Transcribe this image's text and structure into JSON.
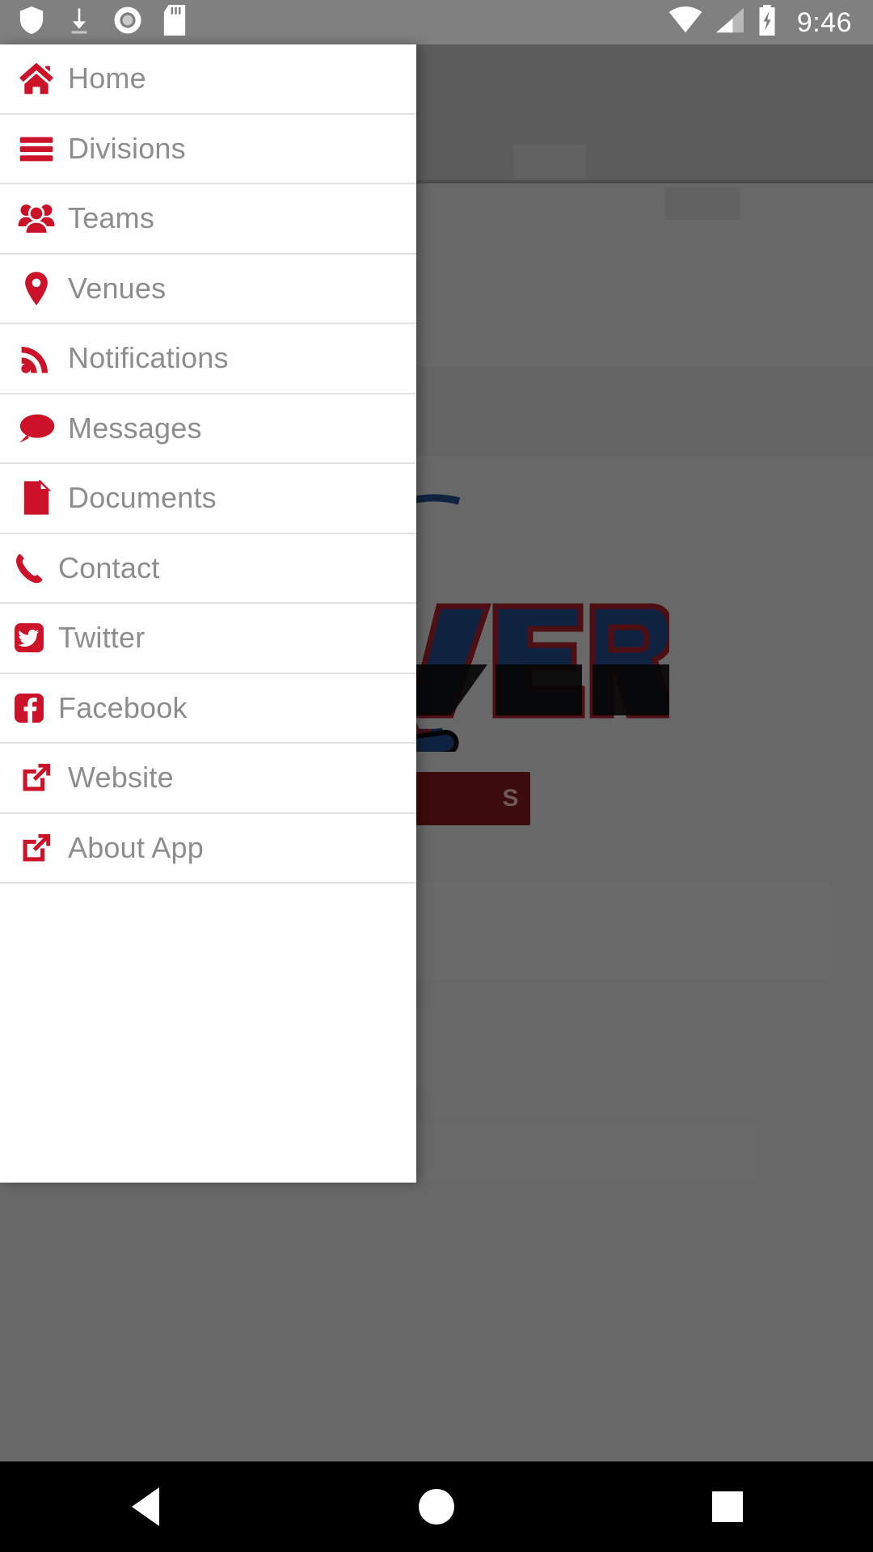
{
  "status_bar": {
    "time": "9:46",
    "left_icons": [
      "shield-icon",
      "download-icon",
      "disc-icon",
      "sd-card-icon"
    ],
    "right_icons": [
      "wifi-icon",
      "cell-signal-icon",
      "battery-charging-icon"
    ],
    "background_color": "#808080"
  },
  "drawer": {
    "accent_color": "#cc1228",
    "label_color": "#8d8d8d",
    "background_color": "#ffffff",
    "items": [
      {
        "label": "Home",
        "icon": "home-icon"
      },
      {
        "label": "Divisions",
        "icon": "list-bars-icon"
      },
      {
        "label": "Teams",
        "icon": "users-group-icon"
      },
      {
        "label": "Venues",
        "icon": "map-marker-icon"
      },
      {
        "label": "Notifications",
        "icon": "rss-feed-icon"
      },
      {
        "label": "Messages",
        "icon": "comment-bubble-icon"
      },
      {
        "label": "Documents",
        "icon": "file-document-icon"
      },
      {
        "label": "Contact",
        "icon": "phone-icon"
      },
      {
        "label": "Twitter",
        "icon": "twitter-icon"
      },
      {
        "label": "Facebook",
        "icon": "facebook-icon"
      },
      {
        "label": "Website",
        "icon": "external-link-icon"
      },
      {
        "label": "About App",
        "icon": "external-link-icon"
      }
    ]
  },
  "background_app": {
    "logo_text_partial": "VER",
    "logo_colors": {
      "navy": "#1d3f73",
      "red": "#8c1a25",
      "black": "#0c0c0c"
    },
    "action_button_label": "S",
    "action_button_color": "#6e1414"
  },
  "nav_bar": {
    "buttons": [
      "back-button",
      "home-button",
      "recents-button"
    ],
    "background_color": "#000000"
  }
}
